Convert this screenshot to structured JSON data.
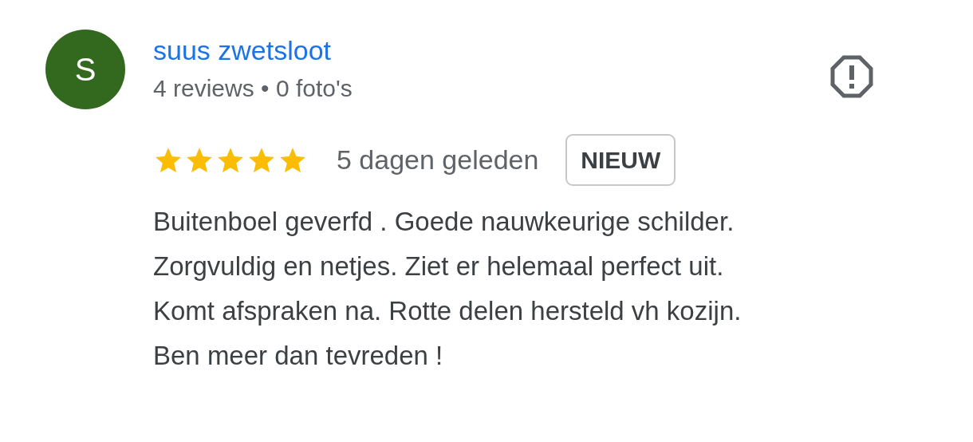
{
  "review": {
    "avatar_letter": "S",
    "author": "suus zwetsloot",
    "meta": "4 reviews • 0 foto's",
    "stars": 5,
    "date": "5 dagen geleden",
    "badge": "NIEUW",
    "text_lines": [
      "Buitenboel geverfd . Goede nauwkeurige schilder.",
      "Zorgvuldig en netjes. Ziet er helemaal perfect uit.",
      "Komt afspraken na. Rotte delen hersteld vh kozijn.",
      "Ben meer dan tevreden !"
    ]
  }
}
